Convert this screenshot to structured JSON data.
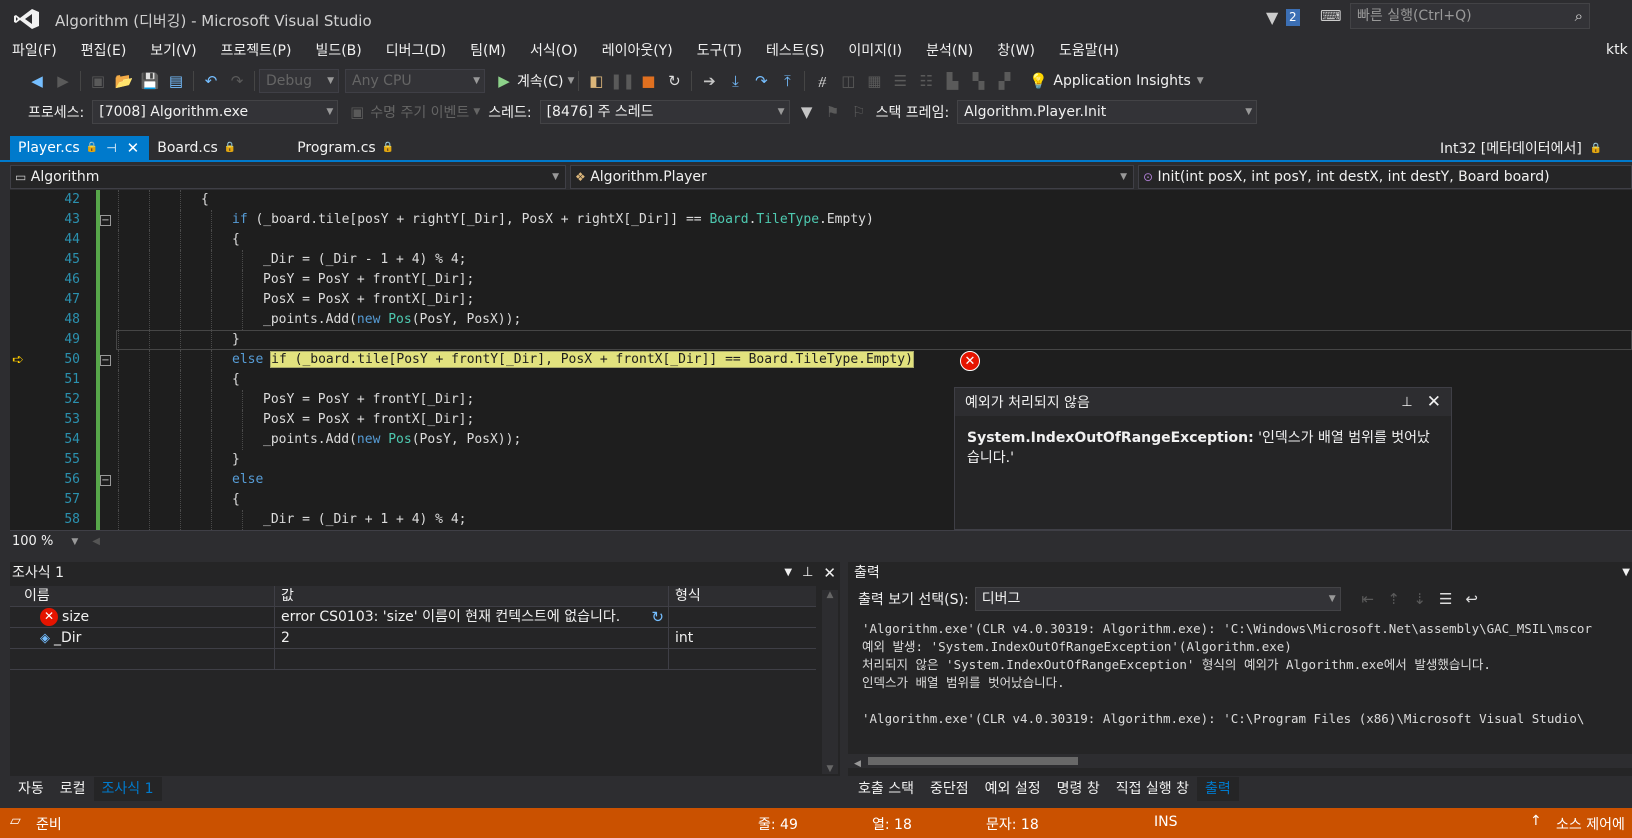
{
  "window": {
    "title": "Algorithm (디버깅) - Microsoft Visual Studio",
    "notif_count": "2",
    "quick_launch_placeholder": "빠른 실행(Ctrl+Q)",
    "user": "ktk"
  },
  "menu": [
    "파일(F)",
    "편집(E)",
    "보기(V)",
    "프로젝트(P)",
    "빌드(B)",
    "디버그(D)",
    "팀(M)",
    "서식(O)",
    "레이아웃(Y)",
    "도구(T)",
    "테스트(S)",
    "이미지(I)",
    "분석(N)",
    "창(W)",
    "도움말(H)"
  ],
  "toolbar": {
    "config": "Debug",
    "platform": "Any CPU",
    "continue": "계속(C)",
    "app_insights": "Application Insights"
  },
  "debugbar": {
    "process_label": "프로세스:",
    "process": "[7008] Algorithm.exe",
    "lifecycle": "수명 주기 이벤트",
    "thread_label": "스레드:",
    "thread": "[8476] 주 스레드",
    "stack_label": "스택 프레임:",
    "stack": "Algorithm.Player.Init"
  },
  "tabs": [
    {
      "label": "Player.cs",
      "active": true
    },
    {
      "label": "Board.cs"
    },
    {
      "label": "Program.cs"
    }
  ],
  "right_tab": "Int32 [메타데이터에서]",
  "nav": {
    "project": "Algorithm",
    "class": "Algorithm.Player",
    "member": "Init(int posX, int posY, int destX, int destY, Board board)"
  },
  "code": [
    {
      "n": "42",
      "indent": 6,
      "parts": [
        {
          "t": "{",
          "c": "tx"
        }
      ]
    },
    {
      "n": "43",
      "indent": 7,
      "parts": [
        {
          "t": "if",
          "c": "kw"
        },
        {
          "t": " (_board.tile[posY + rightY[_Dir], PosX + rightX[_Dir]] == ",
          "c": "tx"
        },
        {
          "t": "Board",
          "c": "ty"
        },
        {
          "t": ".",
          "c": "tx"
        },
        {
          "t": "TileType",
          "c": "ty"
        },
        {
          "t": ".Empty)",
          "c": "tx"
        }
      ]
    },
    {
      "n": "44",
      "indent": 7,
      "parts": [
        {
          "t": "{",
          "c": "tx"
        }
      ]
    },
    {
      "n": "45",
      "indent": 8,
      "parts": [
        {
          "t": "_Dir = (_Dir - 1 + 4) % 4;",
          "c": "tx"
        }
      ]
    },
    {
      "n": "46",
      "indent": 8,
      "parts": [
        {
          "t": "PosY = PosY + frontY[_Dir];",
          "c": "tx"
        }
      ]
    },
    {
      "n": "47",
      "indent": 8,
      "parts": [
        {
          "t": "PosX = PosX + frontX[_Dir];",
          "c": "tx"
        }
      ]
    },
    {
      "n": "48",
      "indent": 8,
      "parts": [
        {
          "t": "_points.Add(",
          "c": "tx"
        },
        {
          "t": "new",
          "c": "kw"
        },
        {
          "t": " ",
          "c": "tx"
        },
        {
          "t": "Pos",
          "c": "ty"
        },
        {
          "t": "(PosY, PosX));",
          "c": "tx"
        }
      ]
    },
    {
      "n": "49",
      "indent": 7,
      "parts": [
        {
          "t": "}",
          "c": "tx"
        }
      ]
    },
    {
      "n": "50",
      "indent": 7,
      "parts": [
        {
          "t": "else ",
          "c": "kw"
        },
        {
          "t": "if (_board.tile[PosY + frontY[_Dir], PosX + frontX[_Dir]] == Board.TileType.Empty)",
          "c": "hl"
        }
      ]
    },
    {
      "n": "51",
      "indent": 7,
      "parts": [
        {
          "t": "{",
          "c": "tx"
        }
      ]
    },
    {
      "n": "52",
      "indent": 8,
      "parts": [
        {
          "t": "PosY = PosY + frontY[_Dir];",
          "c": "tx"
        }
      ]
    },
    {
      "n": "53",
      "indent": 8,
      "parts": [
        {
          "t": "PosX = PosX + frontX[_Dir];",
          "c": "tx"
        }
      ]
    },
    {
      "n": "54",
      "indent": 8,
      "parts": [
        {
          "t": "_points.Add(",
          "c": "tx"
        },
        {
          "t": "new",
          "c": "kw"
        },
        {
          "t": " ",
          "c": "tx"
        },
        {
          "t": "Pos",
          "c": "ty"
        },
        {
          "t": "(PosY, PosX));",
          "c": "tx"
        }
      ]
    },
    {
      "n": "55",
      "indent": 7,
      "parts": [
        {
          "t": "}",
          "c": "tx"
        }
      ]
    },
    {
      "n": "56",
      "indent": 7,
      "parts": [
        {
          "t": "else",
          "c": "kw"
        }
      ]
    },
    {
      "n": "57",
      "indent": 7,
      "parts": [
        {
          "t": "{",
          "c": "tx"
        }
      ]
    },
    {
      "n": "58",
      "indent": 8,
      "parts": [
        {
          "t": "_Dir = (_Dir + 1 + 4) % 4;",
          "c": "tx"
        }
      ]
    }
  ],
  "exception": {
    "title": "예외가 처리되지 않음",
    "type": "System.IndexOutOfRangeException:",
    "message": " '인덱스가 배열 범위를 벗어났습니다.'"
  },
  "zoom": "100 %",
  "watch": {
    "title": "조사식 1",
    "columns": [
      "이름",
      "값",
      "형식"
    ],
    "rows": [
      {
        "name": "size",
        "value": "error CS0103: 'size' 이름이 현재 컨텍스트에 없습니다.",
        "type": ""
      },
      {
        "name": "_Dir",
        "value": "2",
        "type": "int"
      }
    ],
    "bottom_tabs": [
      "자동",
      "로컬",
      "조사식 1"
    ]
  },
  "output": {
    "title": "출력",
    "source_label": "출력 보기 선택(S):",
    "source": "디버그",
    "lines": [
      "'Algorithm.exe'(CLR v4.0.30319: Algorithm.exe): 'C:\\Windows\\Microsoft.Net\\assembly\\GAC_MSIL\\mscor",
      "예외 발생: 'System.IndexOutOfRangeException'(Algorithm.exe)",
      "처리되지 않은 'System.IndexOutOfRangeException' 형식의 예외가 Algorithm.exe에서 발생했습니다.",
      "인덱스가 배열 범위를 벗어났습니다.",
      "",
      "'Algorithm.exe'(CLR v4.0.30319: Algorithm.exe): 'C:\\Program Files (x86)\\Microsoft Visual Studio\\"
    ],
    "bottom_tabs": [
      "호출 스택",
      "중단점",
      "예외 설정",
      "명령 창",
      "직접 실행 창",
      "출력"
    ]
  },
  "status": {
    "ready": "준비",
    "line": "줄: 49",
    "col": "열: 18",
    "char": "문자: 18",
    "mode": "INS",
    "source_control": "소스 제어에"
  }
}
